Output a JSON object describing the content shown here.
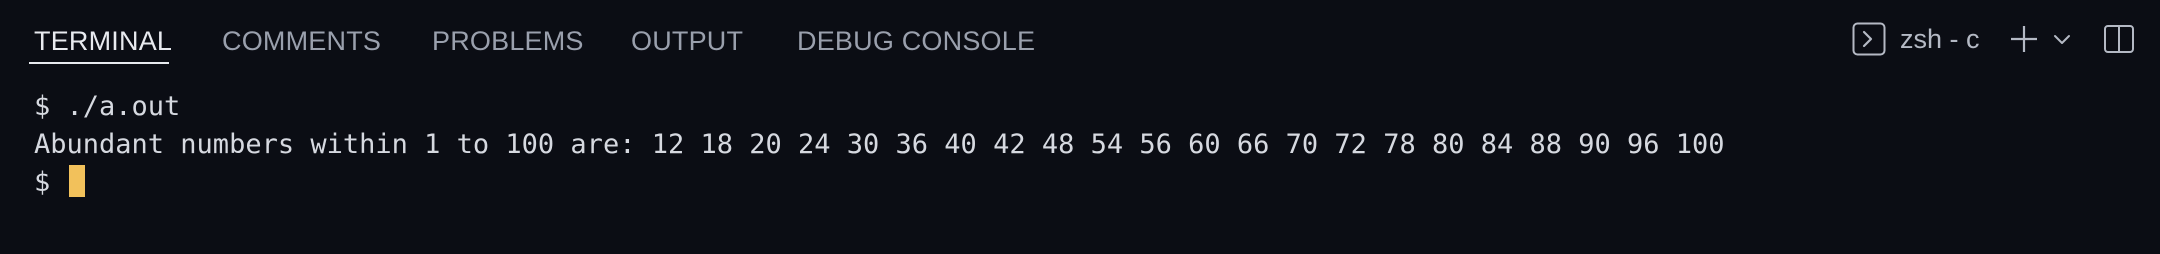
{
  "tabs": [
    {
      "label": "TERMINAL",
      "active": true
    },
    {
      "label": "COMMENTS",
      "active": false
    },
    {
      "label": "PROBLEMS",
      "active": false
    },
    {
      "label": "OUTPUT",
      "active": false
    },
    {
      "label": "DEBUG CONSOLE",
      "active": false
    }
  ],
  "toolbar": {
    "terminal_name": "zsh - c",
    "terminal_icon": "terminal-prompt-icon",
    "add_icon": "plus-icon",
    "dropdown_icon": "chevron-down-icon",
    "split_icon": "split-panel-icon"
  },
  "terminal": {
    "lines": [
      "$ ./a.out",
      "Abundant numbers within 1 to 100 are: 12 18 20 24 30 36 40 42 48 54 56 60 66 70 72 78 80 84 88 90 96 100"
    ],
    "prompt": "$ "
  },
  "colors": {
    "background": "#0b0d14",
    "active_tab": "#e8eaef",
    "inactive_tab": "#9aa0ad",
    "cursor": "#f2c15b",
    "text": "#d6d9e0"
  }
}
